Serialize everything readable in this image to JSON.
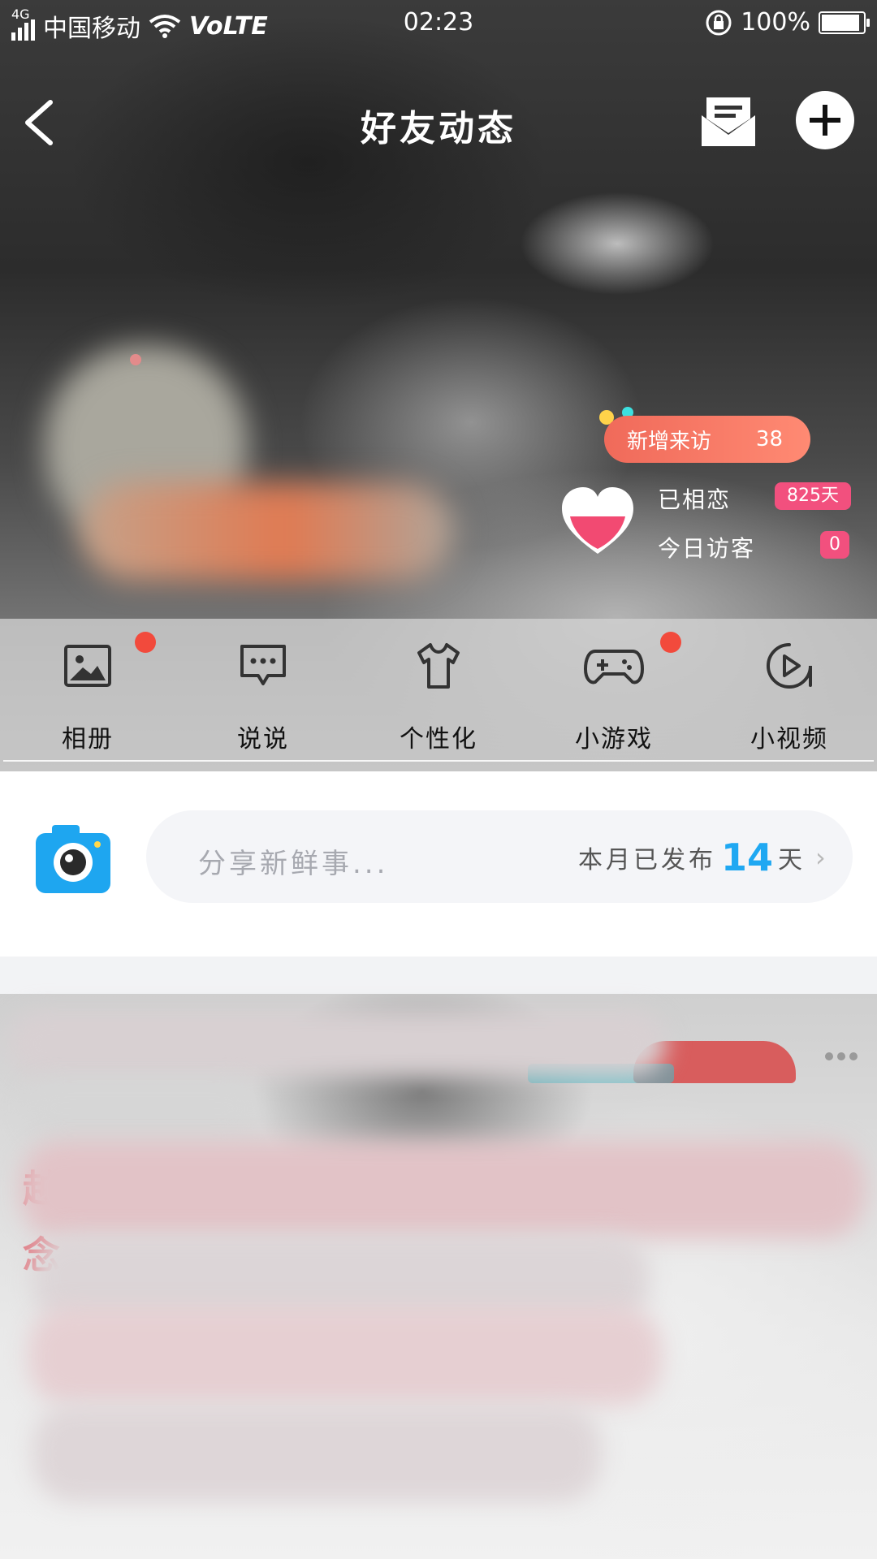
{
  "status_bar": {
    "network_tag": "4G",
    "carrier": "中国移动",
    "volte": "VoLTE",
    "time": "02:23",
    "battery": "100%",
    "battery_level": 1.0
  },
  "header": {
    "title": "好友动态"
  },
  "visitors": {
    "new_visitors_label": "新增来访",
    "new_visitors_count": "38",
    "together_label": "已相恋",
    "together_value": "825天",
    "today_visitors_label": "今日访客",
    "today_visitors_value": "0"
  },
  "features": [
    {
      "label": "相册",
      "icon": "photo-album-icon",
      "has_dot": true
    },
    {
      "label": "说说",
      "icon": "chat-bubble-icon",
      "has_dot": false
    },
    {
      "label": "个性化",
      "icon": "tshirt-icon",
      "has_dot": false
    },
    {
      "label": "小游戏",
      "icon": "gamepad-icon",
      "has_dot": true
    },
    {
      "label": "小视频",
      "icon": "play-video-icon",
      "has_dot": false
    }
  ],
  "share": {
    "placeholder": "分享新鲜事...",
    "published_prefix": "本月已发布",
    "published_days": "14",
    "published_suffix": "天"
  },
  "colors": {
    "accent_blue": "#1fa8f2",
    "badge_pink": "#f2507e",
    "visitor_pill": "#f06a5a",
    "notification_dot": "#f24a3c"
  }
}
